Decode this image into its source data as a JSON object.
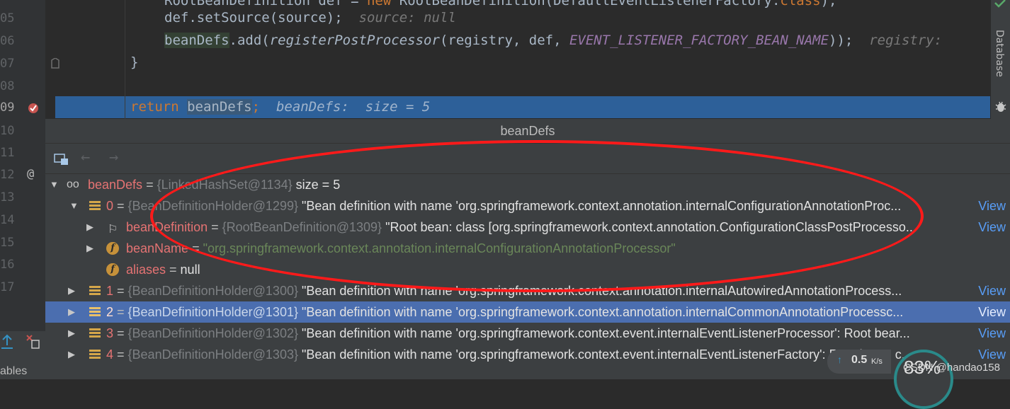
{
  "line_numbers": [
    "05",
    "06",
    "07",
    "08",
    "09",
    "10",
    "11",
    "12",
    "13",
    "14",
    "15",
    "16",
    "17"
  ],
  "code": {
    "l05": {
      "text": "def.setSource(source);",
      "hint": "source: null"
    },
    "l06": {
      "a": "beanDefs",
      "b": ".add(",
      "fn": "registerPostProcessor",
      "c": "(registry, def, ",
      "const": "EVENT_LISTENER_FACTORY_BEAN_NAME",
      "d": "));",
      "hint": "registry:"
    },
    "l07": {
      "text": "}"
    },
    "l09": {
      "kw": "return",
      "var": "beanDefs",
      "semi": ";",
      "hint": "beanDefs:  size = 5"
    }
  },
  "right_strip": {
    "label": "Database"
  },
  "popup": {
    "title": "beanDefs",
    "rows": [
      {
        "name": "beanDefs",
        "eq": " = ",
        "ref": "{LinkedHashSet@1134}",
        "value": " size = 5"
      },
      {
        "name": "0",
        "eq": " = ",
        "ref": "{BeanDefinitionHolder@1299}",
        "value": " \"Bean definition with name 'org.springframework.context.annotation.internalConfigurationAnnotationProc...",
        "view": "View"
      },
      {
        "name": "beanDefinition",
        "eq": " = ",
        "ref": "{RootBeanDefinition@1309}",
        "value": " \"Root bean: class [org.springframework.context.annotation.ConfigurationClassPostProcesso...",
        "view": "View"
      },
      {
        "name": "beanName",
        "eq": " = ",
        "value": "\"org.springframework.context.annotation.internalConfigurationAnnotationProcessor\""
      },
      {
        "name": "aliases",
        "eq": " = ",
        "value": "null"
      },
      {
        "name": "1",
        "eq": " = ",
        "ref": "{BeanDefinitionHolder@1300}",
        "value": " \"Bean definition with name 'org.springframework.context.annotation.internalAutowiredAnnotationProcess...",
        "view": "View"
      },
      {
        "name": "2",
        "eq": " = ",
        "ref": "{BeanDefinitionHolder@1301}",
        "value": " \"Bean definition with name 'org.springframework.context.annotation.internalCommonAnnotationProcessc...",
        "view": "View"
      },
      {
        "name": "3",
        "eq": " = ",
        "ref": "{BeanDefinitionHolder@1302}",
        "value": " \"Bean definition with name 'org.springframework.context.event.internalEventListenerProcessor': Root bear...",
        "view": "View"
      },
      {
        "name": "4",
        "eq": " = ",
        "ref": "{BeanDefinitionHolder@1303}",
        "value": " \"Bean definition with name 'org.springframework.context.event.internalEventListenerFactory': Root bean: c...",
        "view": "View"
      }
    ]
  },
  "bottom_left": {
    "label": "ables"
  },
  "network": {
    "speed": "0.5",
    "unit": "K/s",
    "percent": "83%"
  },
  "watermark": "CSDN @handao158",
  "colors": {
    "selection": "#4b6eaf",
    "exec_line": "#2d6099",
    "annotation": "#ff1a1a"
  }
}
